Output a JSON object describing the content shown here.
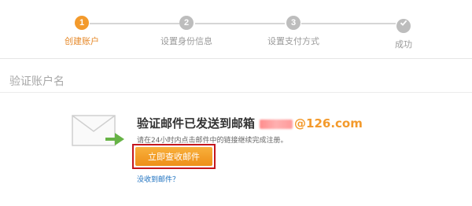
{
  "steps": [
    {
      "number": "1",
      "label": "创建账户",
      "state": "active"
    },
    {
      "number": "2",
      "label": "设置身份信息",
      "state": "pending"
    },
    {
      "number": "3",
      "label": "设置支付方式",
      "state": "pending"
    },
    {
      "number": "",
      "label": "成功",
      "state": "done",
      "icon": "check-icon"
    }
  ],
  "section": {
    "title": "验证账户名"
  },
  "main": {
    "headline_prefix": "验证邮件已发送到邮箱",
    "email_domain": "@126.com",
    "hint": "请在24小时内点击邮件中的链接继续完成注册。",
    "button_label": "立即查收邮件",
    "resend_text": "没收到邮件？",
    "envelope_icon": "envelope-icon",
    "accent_color": "#f39a2c",
    "highlight_color": "#c4161c"
  }
}
